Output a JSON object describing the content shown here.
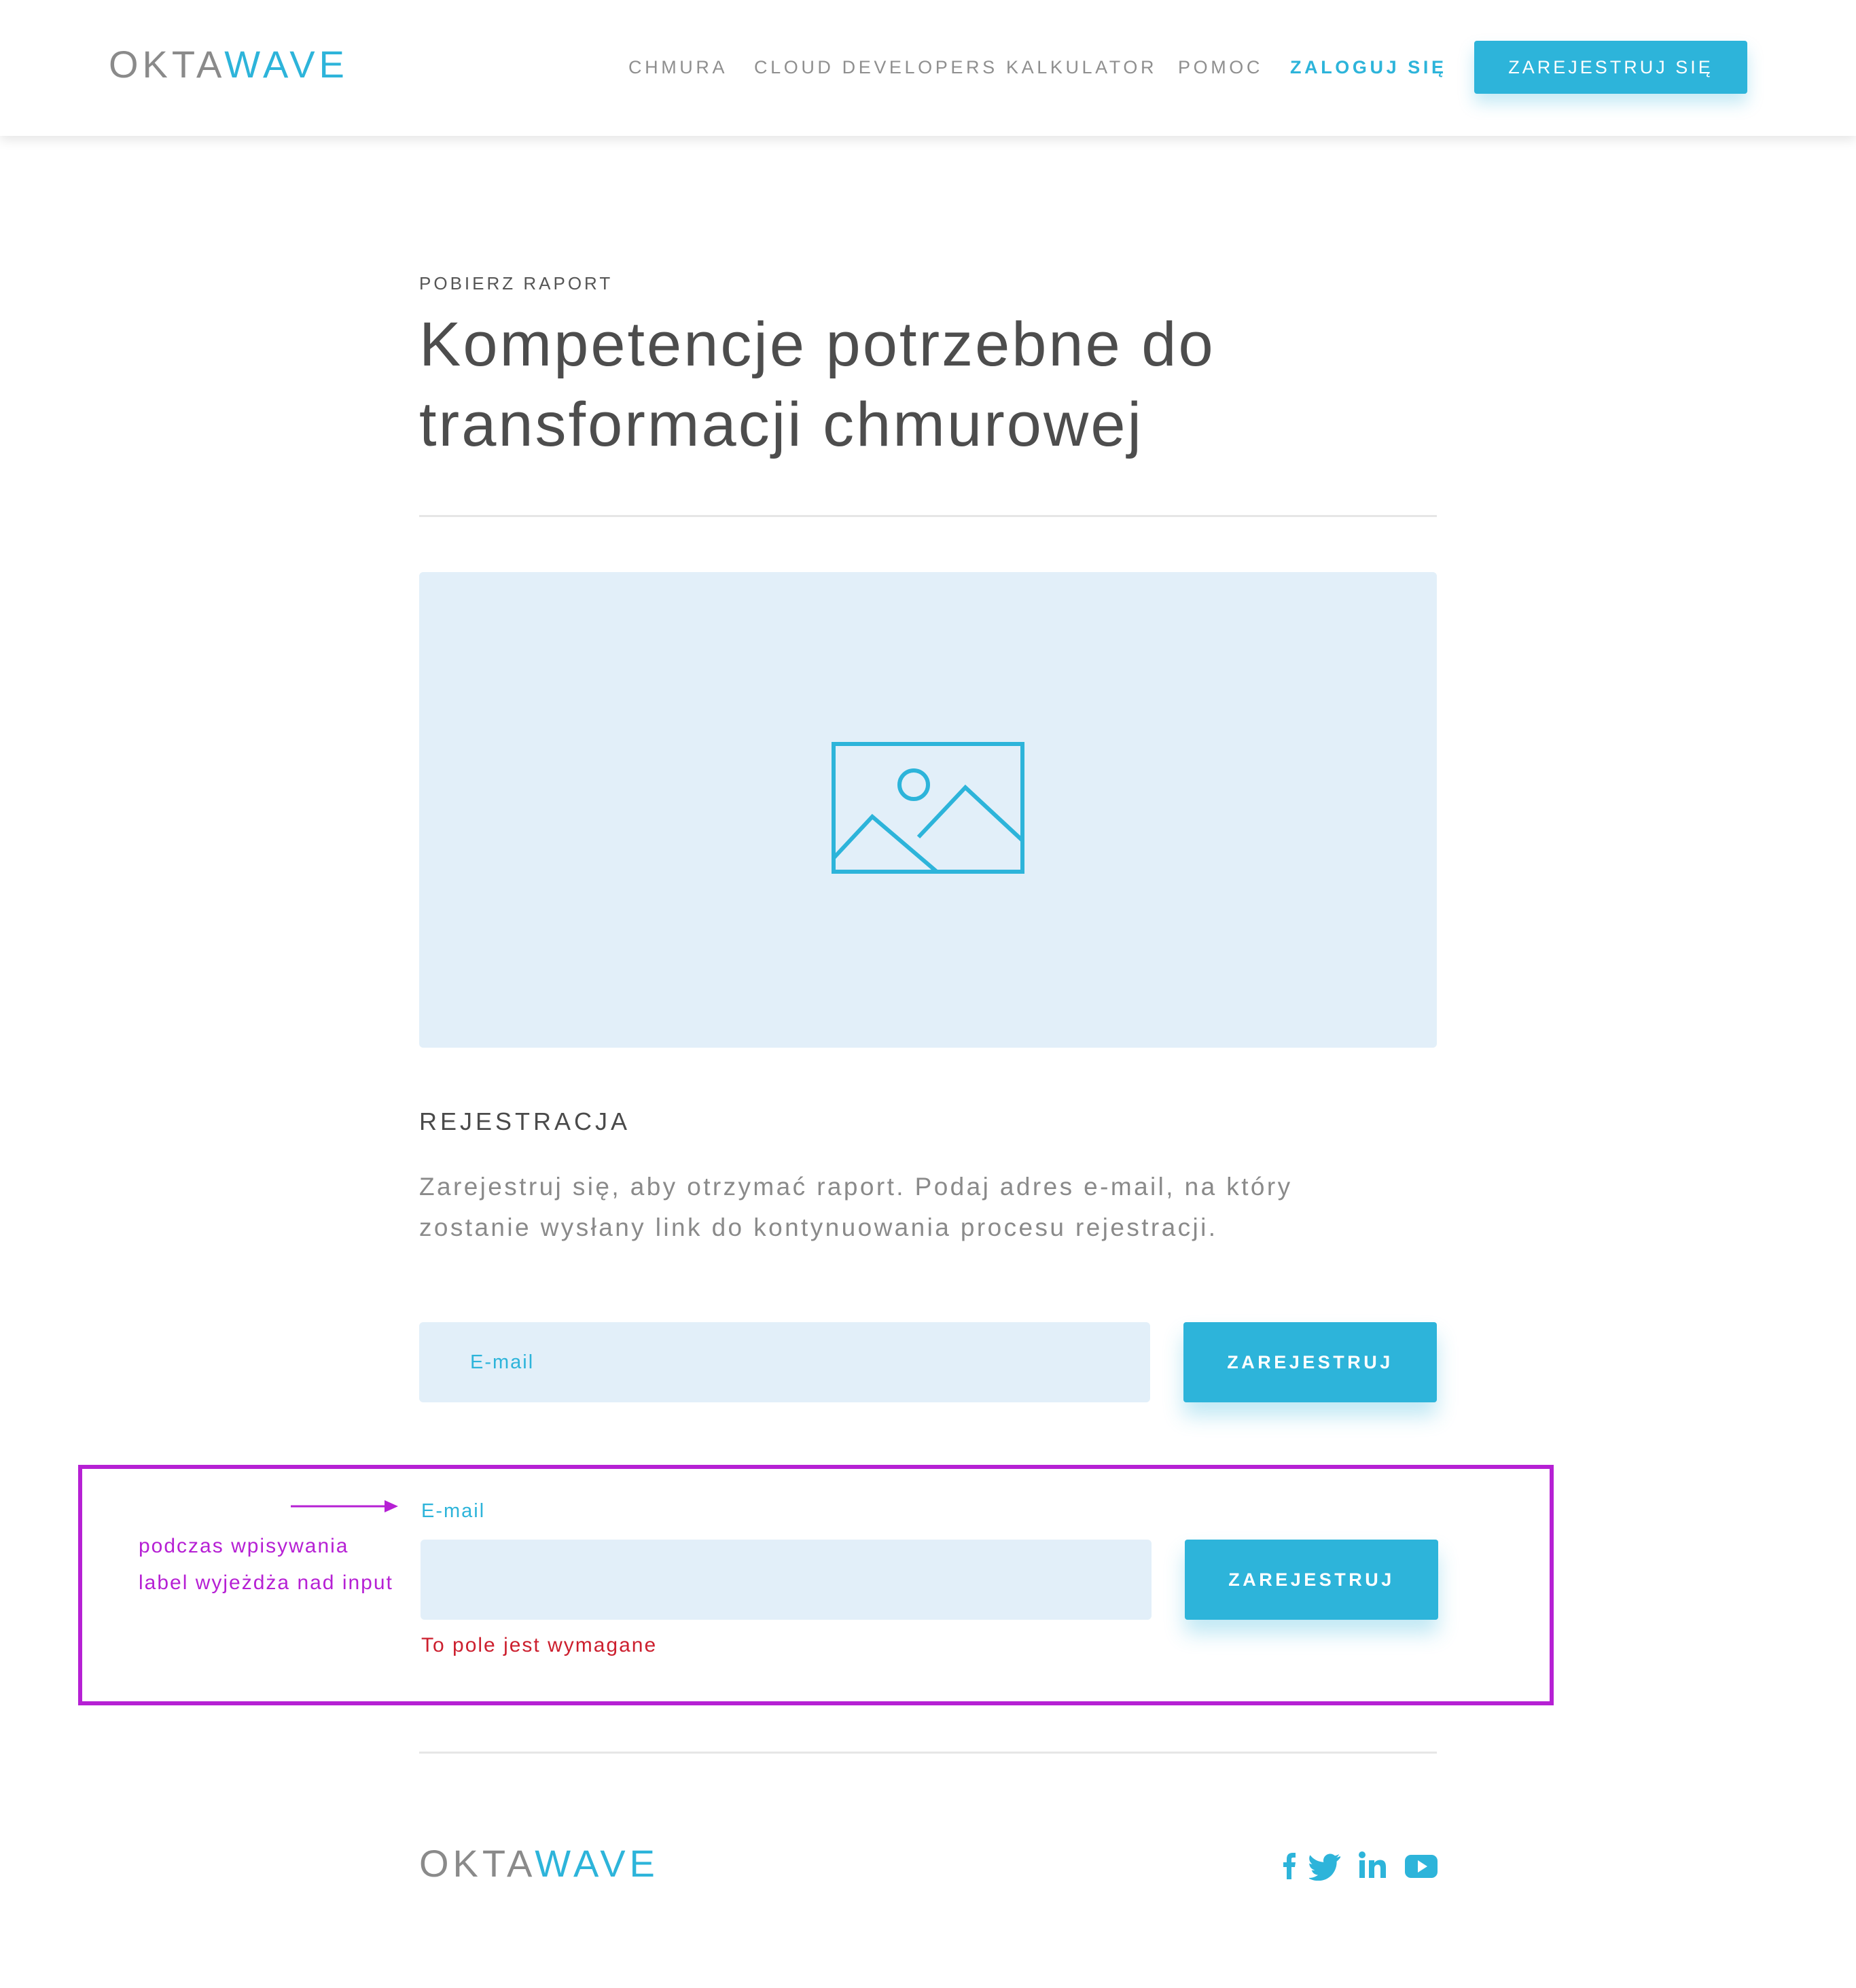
{
  "brand": {
    "logo_part1": "OKTA",
    "logo_part2": "WAVE",
    "accent": "#2db4da",
    "logo_gray": "#8a8a8a"
  },
  "nav": {
    "items": [
      "CHMURA",
      "CLOUD DEVELOPERS",
      "KALKULATOR",
      "POMOC"
    ],
    "login": "ZALOGUJ SIĘ",
    "register": "ZAREJESTRUJ SIĘ"
  },
  "article": {
    "eyebrow": "POBIERZ RAPORT",
    "title": "Kompetencje potrzebne do transformacji chmurowej",
    "image_icon": "image-placeholder-icon"
  },
  "registration": {
    "title": "REJESTRACJA",
    "description": "Zarejestruj się, aby otrzymać raport. Podaj adres e-mail, na który zostanie wysłany link do kontynuowania procesu rejestracji.",
    "email_label": "E-mail",
    "submit": "ZAREJESTRUJ",
    "error_text": "To pole jest wymagane",
    "error_color": "#cc1f2e"
  },
  "annotation": {
    "text": "podczas wpisywania\nlabel wyjeżdża nad input",
    "color": "#b620d4"
  },
  "footer": {
    "social_icons": [
      "facebook-icon",
      "twitter-icon",
      "linkedin-icon",
      "youtube-icon"
    ]
  }
}
